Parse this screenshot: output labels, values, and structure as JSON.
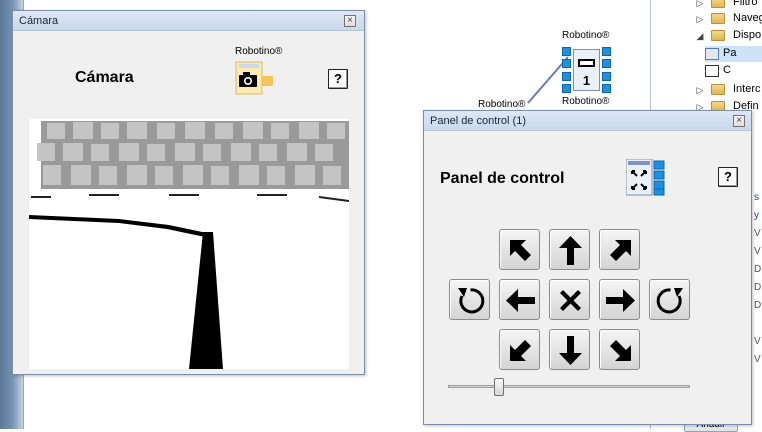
{
  "canvas": {
    "node_label_top": "Robotino®",
    "node_label_bottom": "Robotino®",
    "node_label_left": "Robotino®",
    "node_number": "1"
  },
  "tree": {
    "items": [
      {
        "label": "Filtro",
        "expander": "▷"
      },
      {
        "label": "Naveg",
        "expander": "▷"
      },
      {
        "label": "Dispo",
        "expander": "◢"
      },
      {
        "label": "Pa",
        "expander": ""
      },
      {
        "label": "C",
        "expander": ""
      },
      {
        "label": "Interc",
        "expander": "▷"
      },
      {
        "label": "Defin",
        "expander": "▷"
      }
    ],
    "right_links": [
      "s",
      "y",
      "V",
      "V",
      "D",
      "D",
      "D",
      "V",
      "V"
    ],
    "add_button": "Añadir"
  },
  "camera_window": {
    "title": "Cámara",
    "close": "×",
    "heading": "Cámara",
    "robotino_label": "Robotino®",
    "help": "?"
  },
  "control_window": {
    "title": "Panel de control (1)",
    "close": "×",
    "heading": "Panel de control",
    "help": "?",
    "speed_slider_value": 0.2
  },
  "icons": {
    "camera": "camera-icon",
    "panel": "control-panel-icon",
    "folder": "folder-icon"
  },
  "colors": {
    "accent_blue": "#1e90e0",
    "title_bar": "#c8d8ec",
    "window_bg": "#f0f0f0"
  }
}
